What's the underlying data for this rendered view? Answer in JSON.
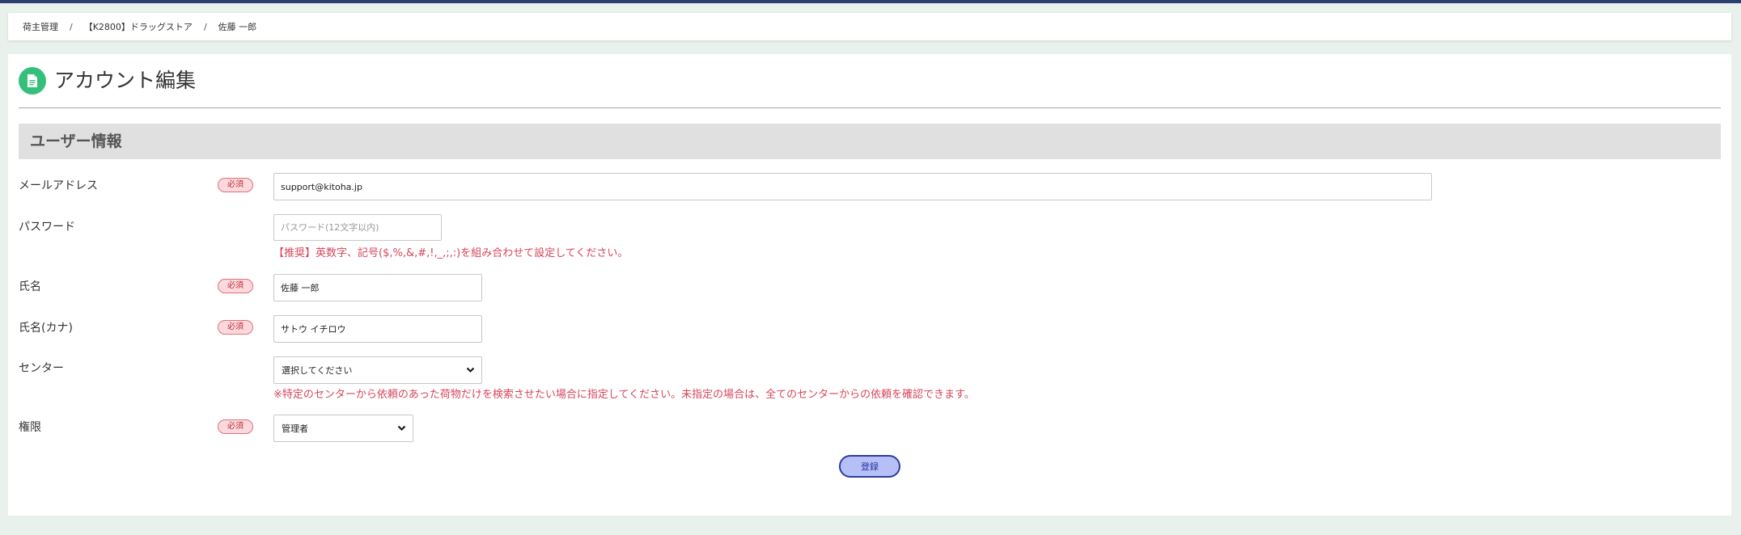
{
  "breadcrumb": {
    "items": [
      "荷主管理",
      "【K2800】ドラッグストア",
      "佐藤 一郎"
    ],
    "separator": "/"
  },
  "page": {
    "title": "アカウント編集",
    "icon": "document-icon",
    "accent_color": "#34c07b"
  },
  "section": {
    "title": "ユーザー情報"
  },
  "required_badge": "必須",
  "form": {
    "email": {
      "label": "メールアドレス",
      "value": "support@kitoha.jp"
    },
    "password": {
      "label": "パスワード",
      "placeholder": "パスワード(12文字以内)",
      "hint": "【推奨】英数字、記号($,%,&,#,!,_,;,:)を組み合わせて設定してください。"
    },
    "name": {
      "label": "氏名",
      "value": "佐藤 一郎"
    },
    "name_kana": {
      "label": "氏名(カナ)",
      "value": "サトウ イチロウ"
    },
    "center": {
      "label": "センター",
      "selected": "選択してください",
      "hint": "※特定のセンターから依頼のあった荷物だけを検索させたい場合に指定してください。未指定の場合は、全てのセンターからの依頼を確認できます。"
    },
    "role": {
      "label": "権限",
      "selected": "管理者"
    }
  },
  "submit_label": "登録"
}
